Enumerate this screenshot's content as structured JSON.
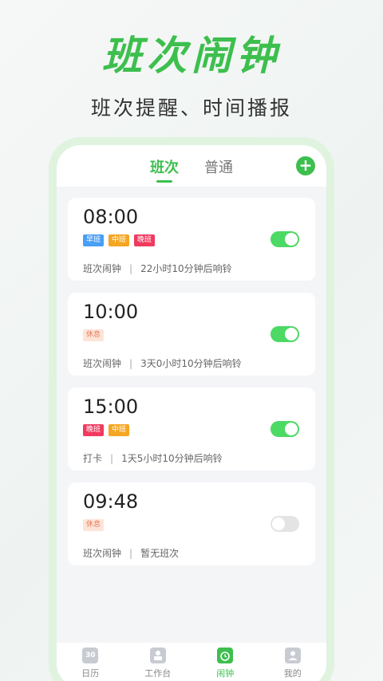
{
  "hero": {
    "title": "班次闹钟",
    "subtitle": "班次提醒、时间播报"
  },
  "tabs": [
    {
      "label": "班次"
    },
    {
      "label": "普通"
    }
  ],
  "add_button_glyph": "+",
  "cards": [
    {
      "time": "08:00",
      "tags": [
        {
          "label": "早班",
          "color": "#4a9ef5"
        },
        {
          "label": "中班",
          "color": "#f5a623"
        },
        {
          "label": "晚班",
          "color": "#f03a5f"
        }
      ],
      "enabled": true,
      "type": "班次闹钟",
      "countdown": "22小时10分钟后响铃"
    },
    {
      "time": "10:00",
      "tags": [
        {
          "label": "休息",
          "color": "#fde4d8"
        }
      ],
      "enabled": true,
      "type": "班次闹钟",
      "countdown": "3天0小时10分钟后响铃"
    },
    {
      "time": "15:00",
      "tags": [
        {
          "label": "晚班",
          "color": "#f03a5f"
        },
        {
          "label": "中班",
          "color": "#f5a623"
        }
      ],
      "enabled": true,
      "type": "打卡",
      "countdown": "1天5小时10分钟后响铃"
    },
    {
      "time": "09:48",
      "tags": [
        {
          "label": "休息",
          "color": "#fde4d8"
        }
      ],
      "enabled": false,
      "type": "班次闹钟",
      "countdown": "暂无班次"
    }
  ],
  "bottom_nav": [
    {
      "label": "日历",
      "icon": "calendar-icon",
      "icon_text": "30"
    },
    {
      "label": "工作台",
      "icon": "workbench-icon",
      "icon_text": ""
    },
    {
      "label": "闹钟",
      "icon": "alarm-clock-icon",
      "icon_text": "",
      "active": true
    },
    {
      "label": "我的",
      "icon": "profile-icon",
      "icon_text": ""
    }
  ],
  "colors": {
    "accent": "#3dbf4e",
    "toggle_on": "#4cd964",
    "toggle_off": "#e4e4e4"
  }
}
